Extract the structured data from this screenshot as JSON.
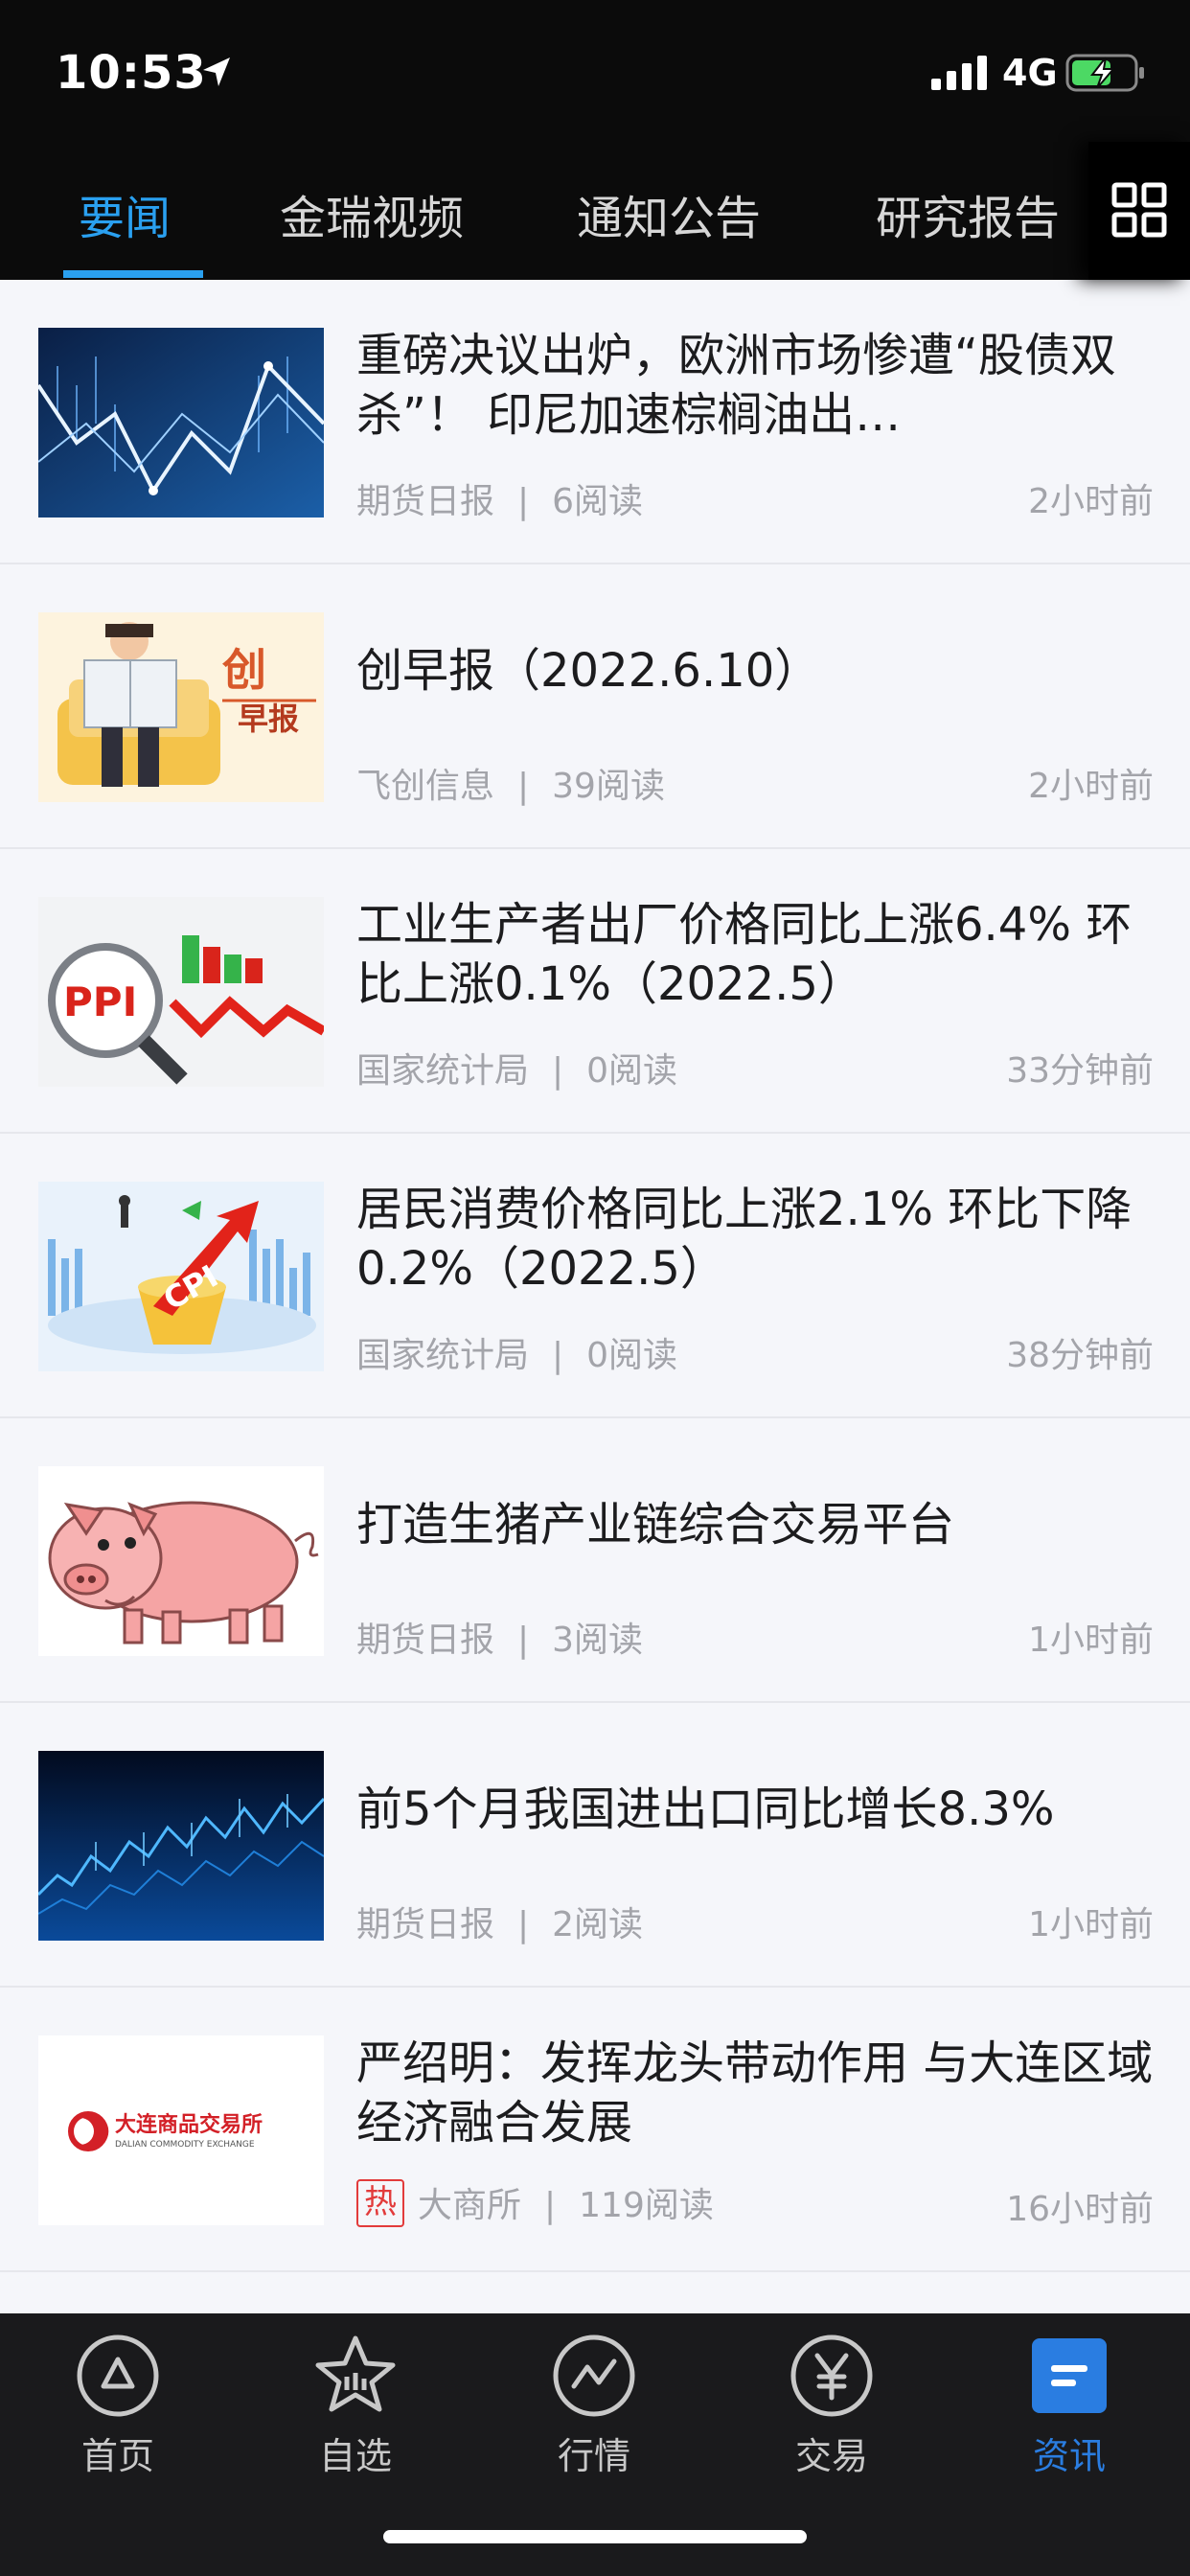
{
  "status_bar": {
    "time": "10:53",
    "network": "4G"
  },
  "tabs": [
    {
      "label": "要闻",
      "active": true
    },
    {
      "label": "金瑞视频",
      "active": false
    },
    {
      "label": "通知公告",
      "active": false
    },
    {
      "label": "研究报告",
      "active": false
    }
  ],
  "news": [
    {
      "title": "重磅决议出炉，欧洲市场惨遭“股债双杀”！ 印尼加速棕榈油出…",
      "source": "期货日报",
      "reads": "6阅读",
      "time": "2小时前",
      "thumb_icon": "stock-chart-thumbnail"
    },
    {
      "title": "创早报（2022.6.10）",
      "source": "飞创信息",
      "reads": "39阅读",
      "time": "2小时前",
      "thumb_icon": "morning-report-thumbnail",
      "thumb_text": [
        "创",
        "早报"
      ]
    },
    {
      "title": "工业生产者出厂价格同比上涨6.4% 环比上涨0.1%（2022.5）",
      "source": "国家统计局",
      "reads": "0阅读",
      "time": "33分钟前",
      "thumb_icon": "ppi-thumbnail",
      "thumb_text": [
        "PPI"
      ]
    },
    {
      "title": "居民消费价格同比上涨2.1% 环比下降0.2%（2022.5）",
      "source": "国家统计局",
      "reads": "0阅读",
      "time": "38分钟前",
      "thumb_icon": "cpi-thumbnail",
      "thumb_text": [
        "CPI"
      ]
    },
    {
      "title": "打造生猪产业链综合交易平台",
      "source": "期货日报",
      "reads": "3阅读",
      "time": "1小时前",
      "thumb_icon": "pig-thumbnail"
    },
    {
      "title": "前5个月我国进出口同比增长8.3%",
      "source": "期货日报",
      "reads": "2阅读",
      "time": "1小时前",
      "thumb_icon": "trade-chart-thumbnail"
    },
    {
      "title": "严绍明：发挥龙头带动作用 与大连区域经济融合发展",
      "source": "大商所",
      "reads": "119阅读",
      "time": "16小时前",
      "badge": "热",
      "thumb_icon": "dce-logo-thumbnail",
      "thumb_text": [
        "大连商品交易所",
        "DALIAN COMMODITY EXCHANGE"
      ]
    }
  ],
  "bottom_nav": [
    {
      "label": "首页",
      "icon": "home-icon",
      "active": false
    },
    {
      "label": "自选",
      "icon": "star-icon",
      "active": false
    },
    {
      "label": "行情",
      "icon": "market-icon",
      "active": false
    },
    {
      "label": "交易",
      "icon": "yuan-icon",
      "active": false
    },
    {
      "label": "资讯",
      "icon": "news-icon",
      "active": true
    }
  ],
  "colors": {
    "accent": "#2aa0f0",
    "nav_active": "#2a7de1",
    "hot": "#e23b3b"
  }
}
